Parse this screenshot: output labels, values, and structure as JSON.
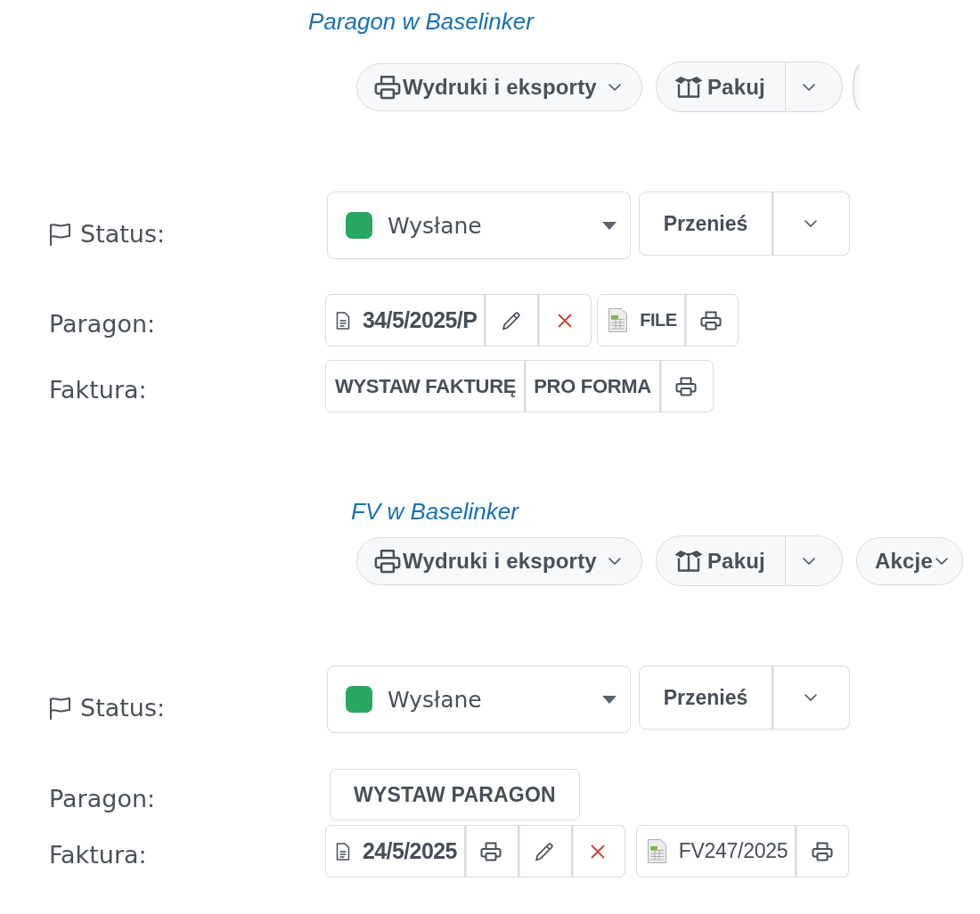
{
  "sections": [
    {
      "title": "Paragon w Baselinker",
      "toolbar": [
        {
          "kind": "icon-menu",
          "label": "Wydruki i eksporty"
        },
        {
          "kind": "split",
          "label": "Pakuj"
        },
        {
          "kind": "clipped"
        }
      ],
      "status": {
        "label": "Status:",
        "value": "Wysłane",
        "color": "#27a763",
        "action": "Przenieś"
      },
      "rows": [
        {
          "label": "Paragon:",
          "groups": [
            [
              {
                "kind": "document",
                "text": "34/5/2025/P"
              },
              {
                "kind": "edit"
              },
              {
                "kind": "delete"
              }
            ],
            [
              {
                "kind": "file",
                "text": "FILE",
                "strong": true
              },
              {
                "kind": "print"
              }
            ]
          ]
        },
        {
          "label": "Faktura:",
          "groups": [
            [
              {
                "kind": "text",
                "text": "WYSTAW FAKTURĘ"
              },
              {
                "kind": "text",
                "text": "PRO FORMA"
              },
              {
                "kind": "print"
              }
            ]
          ]
        }
      ]
    },
    {
      "title": "FV w Baselinker",
      "toolbar": [
        {
          "kind": "icon-menu",
          "label": "Wydruki i eksporty"
        },
        {
          "kind": "split",
          "label": "Pakuj"
        },
        {
          "kind": "menu",
          "label": "Akcje"
        }
      ],
      "status": {
        "label": "Status:",
        "value": "Wysłane",
        "color": "#27a763",
        "action": "Przenieś"
      },
      "rows": [
        {
          "label": "Paragon:",
          "groups": [
            [
              {
                "kind": "text",
                "text": "WYSTAW PARAGON"
              }
            ]
          ]
        },
        {
          "label": "Faktura:",
          "groups": [
            [
              {
                "kind": "document",
                "text": "24/5/2025"
              },
              {
                "kind": "print"
              },
              {
                "kind": "edit"
              },
              {
                "kind": "delete"
              }
            ],
            [
              {
                "kind": "file",
                "text": "FV247/2025",
                "strong": false
              },
              {
                "kind": "print"
              }
            ]
          ]
        }
      ]
    }
  ]
}
